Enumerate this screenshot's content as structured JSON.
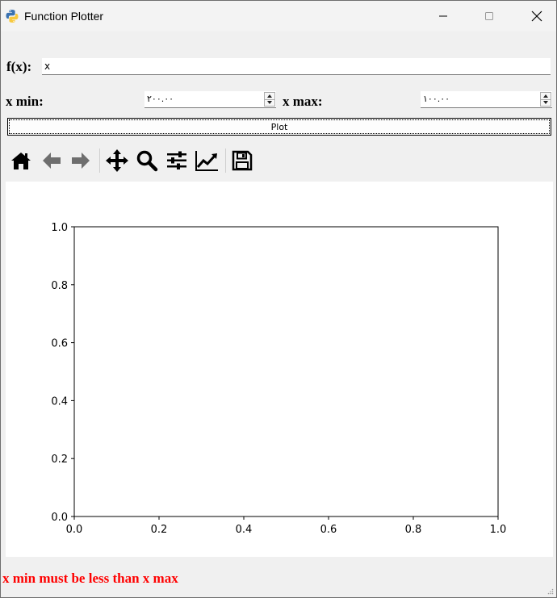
{
  "window": {
    "title": "Function Plotter"
  },
  "form": {
    "fx_label": "f(x):",
    "fx_value": "x",
    "xmin_label": "x min:",
    "xmin_value": "٢٠٠.٠٠",
    "xmax_label": "x max:",
    "xmax_value": "١٠٠.٠٠",
    "plot_button": "Plot"
  },
  "toolbar": {
    "icons": [
      "home-icon",
      "back-arrow-icon",
      "forward-arrow-icon",
      "pan-icon",
      "zoom-icon",
      "configure-subplots-icon",
      "edit-axis-icon",
      "save-icon"
    ]
  },
  "chart_data": {
    "type": "line",
    "series": [],
    "xlim": [
      0.0,
      1.0
    ],
    "ylim": [
      0.0,
      1.0
    ],
    "xticks": [
      "0.0",
      "0.2",
      "0.4",
      "0.6",
      "0.8",
      "1.0"
    ],
    "yticks": [
      "0.0",
      "0.2",
      "0.4",
      "0.6",
      "0.8",
      "1.0"
    ],
    "grid": false
  },
  "status": {
    "error": "x min must be less than x max",
    "error_color": "#ff0000"
  }
}
